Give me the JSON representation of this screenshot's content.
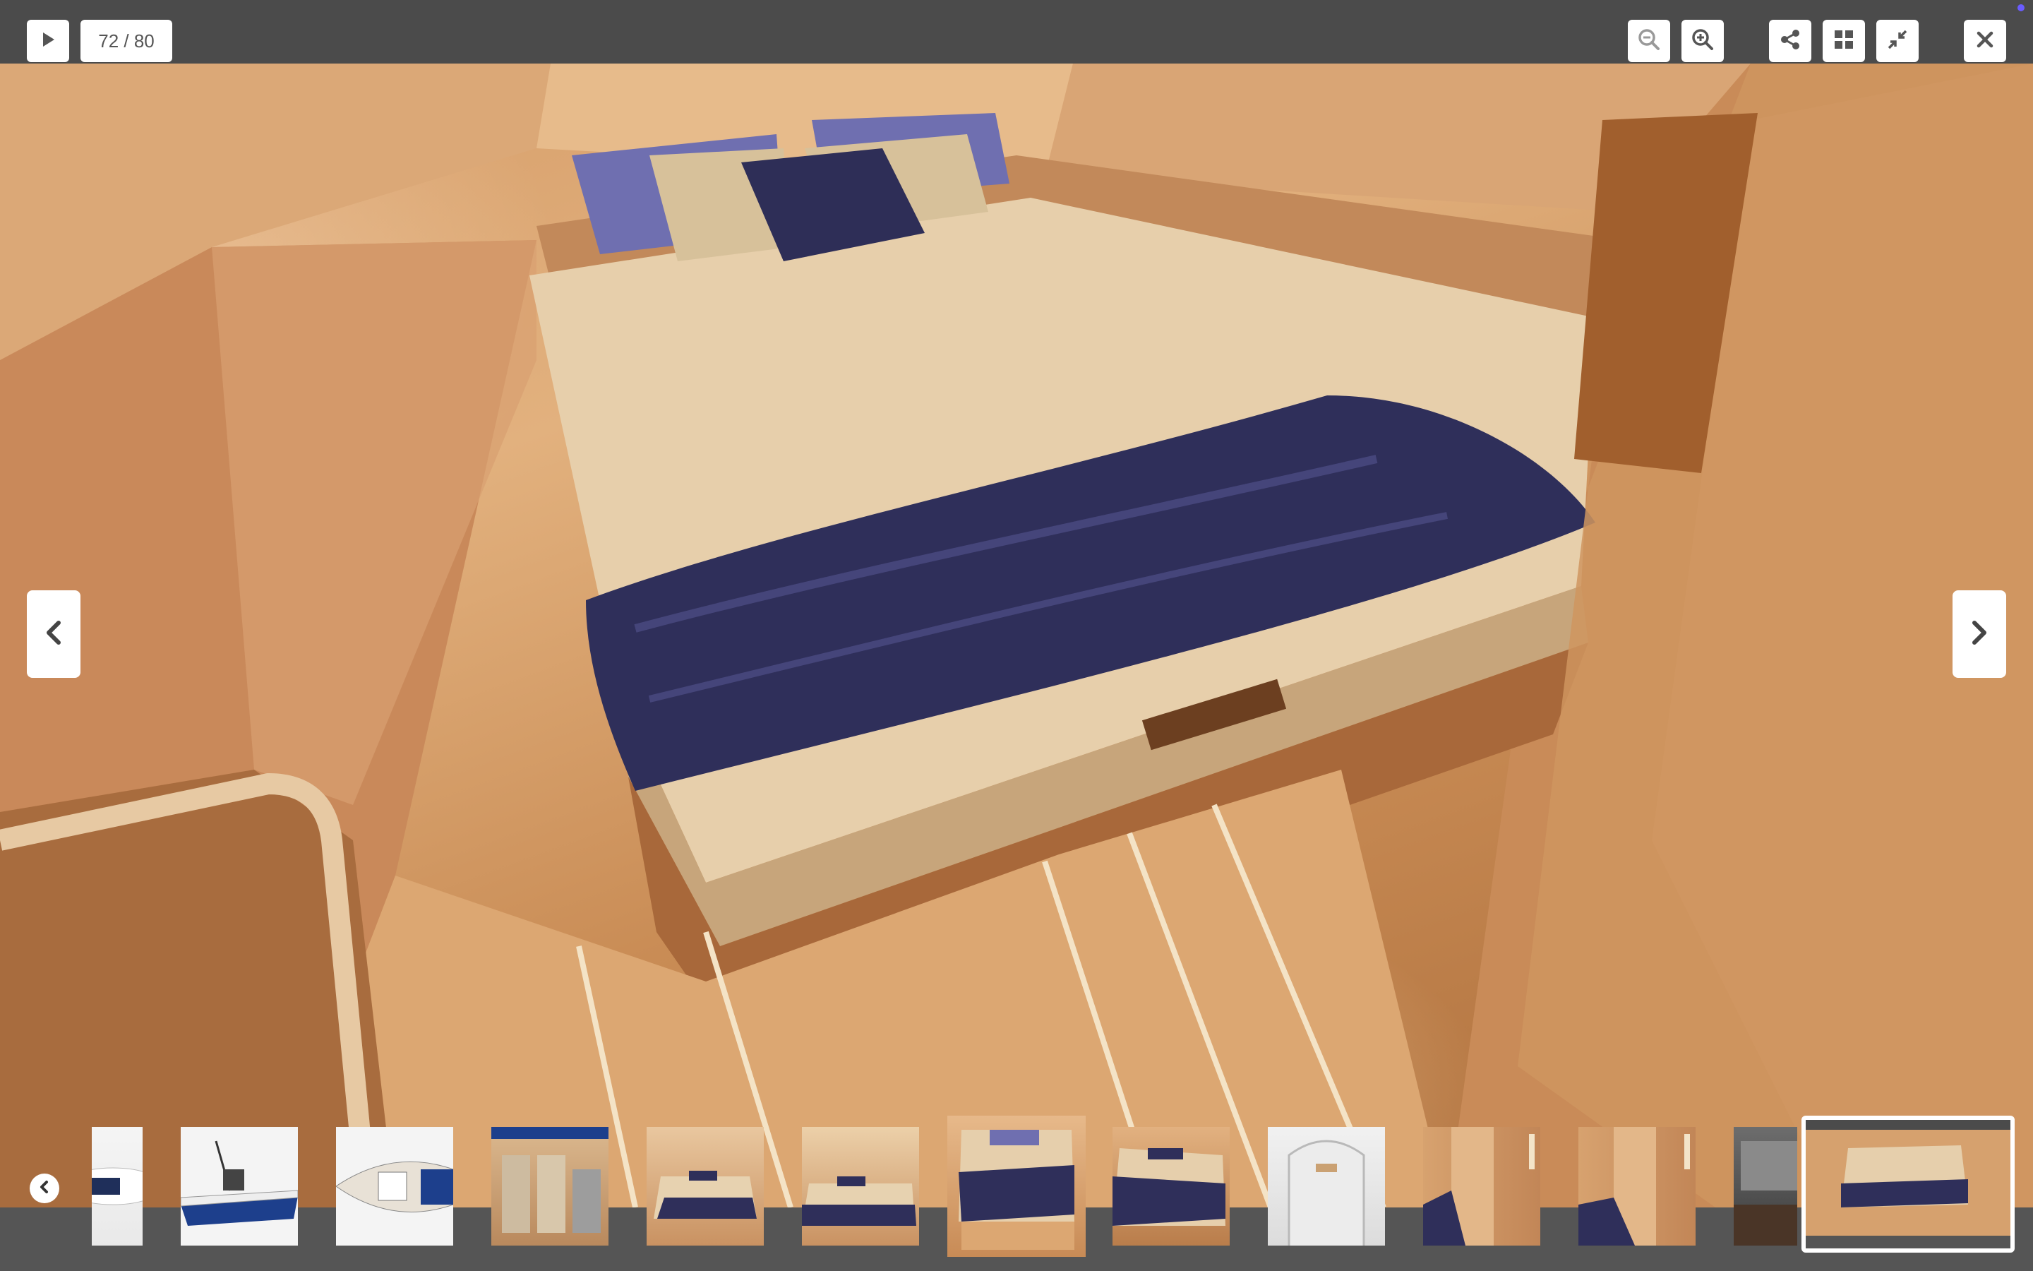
{
  "viewer": {
    "counter": "72 / 80",
    "current": 72,
    "total": 80
  },
  "toolbar": {
    "play_icon": "play-icon",
    "zoom_out_icon": "zoom-out-icon",
    "zoom_in_icon": "zoom-in-icon",
    "share_icon": "share-icon",
    "grid_icon": "grid-icon",
    "exit_fullscreen_icon": "compress-icon",
    "close_icon": "close-icon"
  },
  "navigation": {
    "prev_icon": "chevron-left-icon",
    "next_icon": "chevron-right-icon",
    "strip_prev_icon": "circle-chevron-left-icon"
  },
  "colors": {
    "toolbar_bg": "#4b4b4b",
    "button_bg": "#ffffff",
    "icon": "#555555",
    "accent_dot": "#6a5cff"
  },
  "thumbnails": [
    {
      "kind": "boat-exterior-white-partial"
    },
    {
      "kind": "boat-exterior-side"
    },
    {
      "kind": "boat-top-view"
    },
    {
      "kind": "cabin-shelf-linens"
    },
    {
      "kind": "cabin-bed-wide"
    },
    {
      "kind": "cabin-bed-wide"
    },
    {
      "kind": "cabin-bed-current"
    },
    {
      "kind": "cabin-bed-angle"
    },
    {
      "kind": "cabin-door-white"
    },
    {
      "kind": "cabin-wardrobe"
    },
    {
      "kind": "cabin-wardrobe"
    },
    {
      "kind": "cabin-partial"
    },
    {
      "kind": "screenshot-viewer",
      "active": true
    }
  ]
}
